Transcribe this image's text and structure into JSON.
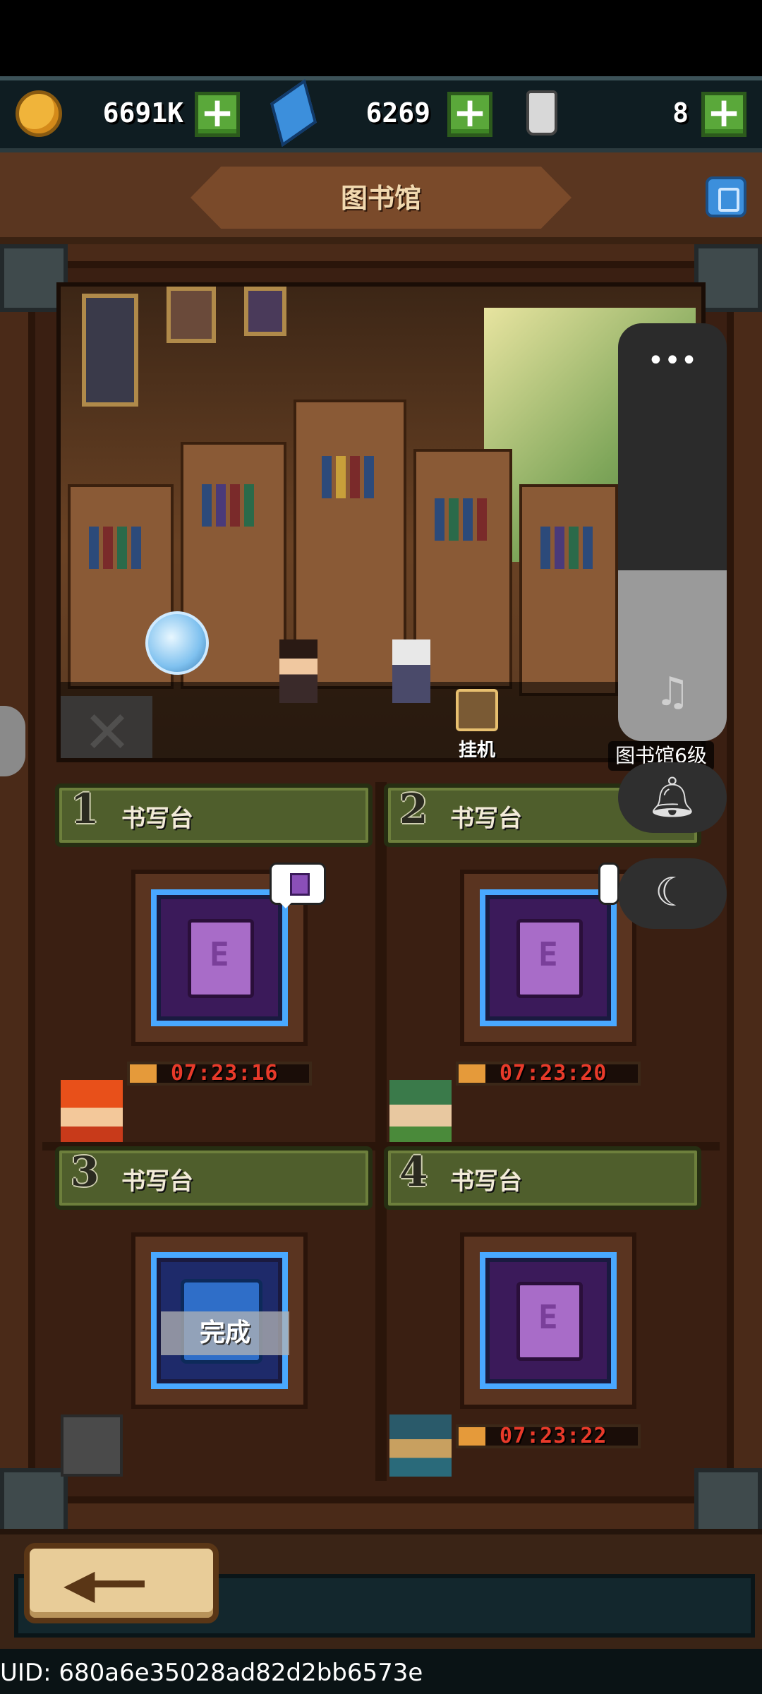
{
  "resources": {
    "gold": {
      "value": "6691K",
      "icon": "gold-coin-icon",
      "color": "#f0b43a"
    },
    "gems": {
      "value": "6269",
      "icon": "blue-crystal-icon",
      "color": "#3c8fdc"
    },
    "potions": {
      "value": "8",
      "icon": "potion-bottle-icon"
    }
  },
  "header": {
    "title": "图书馆"
  },
  "scene": {
    "idle_label": "挂机"
  },
  "overlay": {
    "level_tag": "图书馆6级",
    "more_icon": "•••"
  },
  "stations": [
    {
      "number": "1",
      "label": "书写台",
      "timer": "07:23:16",
      "progress": 0.15,
      "status": "writing"
    },
    {
      "number": "2",
      "label": "书写台",
      "timer": "07:23:20",
      "progress": 0.15,
      "status": "writing"
    },
    {
      "number": "3",
      "label": "书写台",
      "done_label": "完成",
      "status": "done"
    },
    {
      "number": "4",
      "label": "书写台",
      "timer": "07:23:22",
      "progress": 0.15,
      "status": "writing"
    }
  ],
  "footer": {
    "uid": "UID: 680a6e35028ad82d2bb6573e"
  },
  "colors": {
    "accent_green": "#5aa83a",
    "timer_red": "#e83a2a",
    "slot_border": "#49a8ff"
  }
}
